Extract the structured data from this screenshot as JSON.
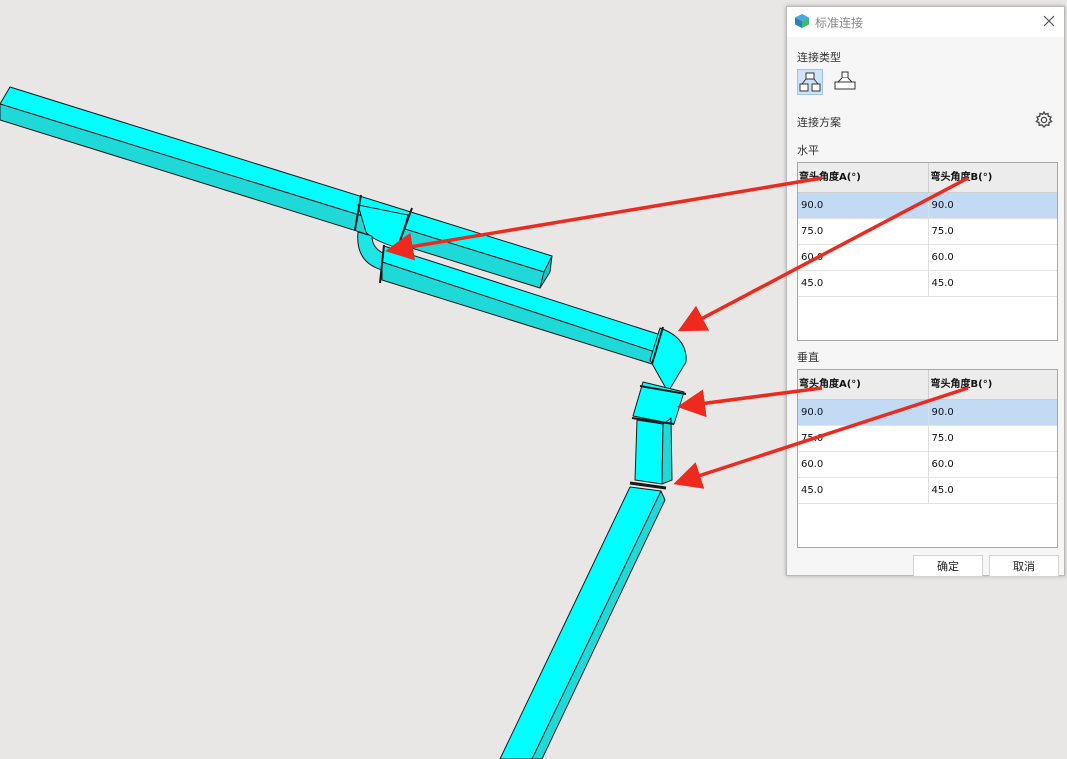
{
  "dialog": {
    "title": "标准连接",
    "connection_type_label": "连接类型",
    "connection_scheme_label": "连接方案",
    "confirm_label": "确定",
    "cancel_label": "取消"
  },
  "horizontal": {
    "label": "水平",
    "columns": [
      "弯头角度A(°)",
      "弯头角度B(°)"
    ],
    "rows": [
      [
        "90.0",
        "90.0"
      ],
      [
        "75.0",
        "75.0"
      ],
      [
        "60.0",
        "60.0"
      ],
      [
        "45.0",
        "45.0"
      ]
    ],
    "selected_row": 0
  },
  "vertical": {
    "label": "垂直",
    "columns": [
      "弯头角度A(°)",
      "弯头角度B(°)"
    ],
    "rows": [
      [
        "90.0",
        "90.0"
      ],
      [
        "75.0",
        "75.0"
      ],
      [
        "60.0",
        "60.0"
      ],
      [
        "45.0",
        "45.0"
      ]
    ],
    "selected_row": 0
  },
  "icons": {
    "app": "cube-app-icon",
    "close": "close-icon",
    "elbow_type": "elbow-connection-icon",
    "tee_type": "tee-connection-icon",
    "settings": "gear-icon"
  },
  "colors": {
    "duct": "#00ffff",
    "duct_side": "#1fd9d9",
    "annotation_arrow": "#ee2a1f",
    "selection": "#c3daf5",
    "canvas": "#e9e7e5"
  }
}
